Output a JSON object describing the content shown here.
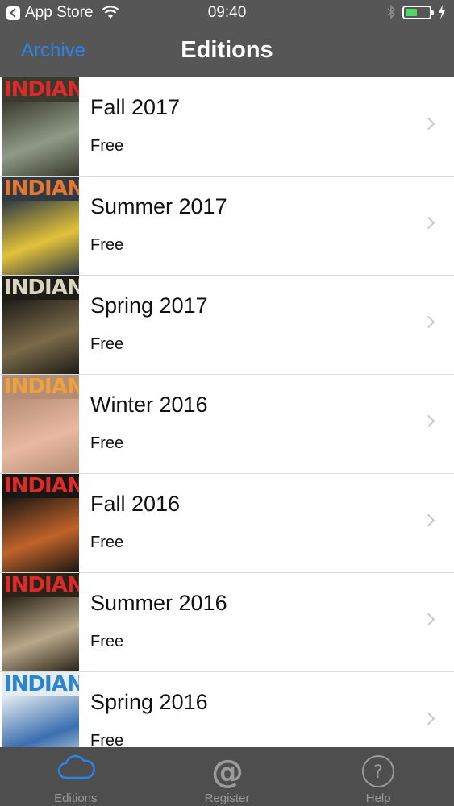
{
  "status_bar": {
    "back_app": "App Store",
    "time": "09:40",
    "battery_level": 0.5
  },
  "nav": {
    "back_label": "Archive",
    "title": "Editions"
  },
  "editions": [
    {
      "title": "Fall 2017",
      "price": "Free",
      "masthead": "INDIAN",
      "masthead_color": "#e02a2a",
      "art_color": "#3a3a2e",
      "accent": "#8f9a86"
    },
    {
      "title": "Summer 2017",
      "price": "Free",
      "masthead": "INDIAN",
      "masthead_color": "#e8762e",
      "art_color": "#2e3a44",
      "accent": "#e3c23a"
    },
    {
      "title": "Spring 2017",
      "price": "Free",
      "masthead": "INDIAN",
      "masthead_color": "#d9d5c0",
      "art_color": "#1d1c17",
      "accent": "#7a6a4a"
    },
    {
      "title": "Winter 2016",
      "price": "Free",
      "masthead": "INDIAN",
      "masthead_color": "#f0a23a",
      "art_color": "#b58d76",
      "accent": "#e9b9a0"
    },
    {
      "title": "Fall 2016",
      "price": "Free",
      "masthead": "INDIAN",
      "masthead_color": "#e02a2a",
      "art_color": "#1a1612",
      "accent": "#c0632a"
    },
    {
      "title": "Summer 2016",
      "price": "Free",
      "masthead": "INDIAN",
      "masthead_color": "#e02a2a",
      "art_color": "#2a2418",
      "accent": "#b8a88a"
    },
    {
      "title": "Spring 2016",
      "price": "Free",
      "masthead": "INDIAN",
      "masthead_color": "#2a84d0",
      "art_color": "#e4ecef",
      "accent": "#3a6fb0"
    }
  ],
  "tabs": [
    {
      "label": "Editions",
      "icon": "cloud-icon",
      "active": true
    },
    {
      "label": "Register",
      "icon": "at-icon",
      "active": false
    },
    {
      "label": "Help",
      "icon": "help-icon",
      "active": false
    }
  ],
  "colors": {
    "accent": "#2a84f0",
    "bar_bg": "#565656",
    "tab_bg": "#4e4e4e"
  }
}
